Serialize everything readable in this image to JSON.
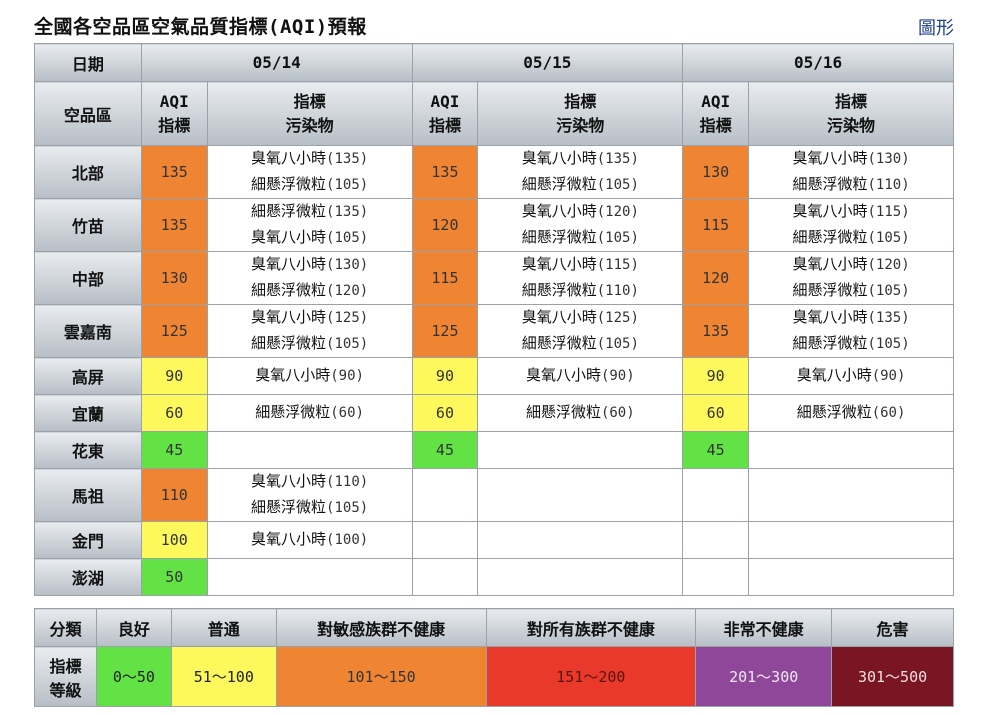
{
  "title": {
    "prefix": "全國各空品區空氣品質指標",
    "code": "(AQI)",
    "suffix": "預報"
  },
  "chart_link": "圖形",
  "header": {
    "date_label": "日期",
    "region_label": "空品區",
    "aqi_label_1": "AQI",
    "aqi_label_2": "指標",
    "poll_label_1": "指標",
    "poll_label_2": "污染物",
    "dates": [
      "05/14",
      "05/15",
      "05/16"
    ]
  },
  "regions": [
    {
      "name": "北部",
      "days": [
        {
          "aqi": "135",
          "level": "orange",
          "pollutants": [
            "臭氧八小時",
            "(135)",
            "細懸浮微粒",
            "(105)"
          ]
        },
        {
          "aqi": "135",
          "level": "orange",
          "pollutants": [
            "臭氧八小時",
            "(135)",
            "細懸浮微粒",
            "(105)"
          ]
        },
        {
          "aqi": "130",
          "level": "orange",
          "pollutants": [
            "臭氧八小時",
            "(130)",
            "細懸浮微粒",
            "(110)"
          ]
        }
      ]
    },
    {
      "name": "竹苗",
      "days": [
        {
          "aqi": "135",
          "level": "orange",
          "pollutants": [
            "細懸浮微粒",
            "(135)",
            "臭氧八小時",
            "(105)"
          ]
        },
        {
          "aqi": "120",
          "level": "orange",
          "pollutants": [
            "臭氧八小時",
            "(120)",
            "細懸浮微粒",
            "(105)"
          ]
        },
        {
          "aqi": "115",
          "level": "orange",
          "pollutants": [
            "臭氧八小時",
            "(115)",
            "細懸浮微粒",
            "(105)"
          ]
        }
      ]
    },
    {
      "name": "中部",
      "days": [
        {
          "aqi": "130",
          "level": "orange",
          "pollutants": [
            "臭氧八小時",
            "(130)",
            "細懸浮微粒",
            "(120)"
          ]
        },
        {
          "aqi": "115",
          "level": "orange",
          "pollutants": [
            "臭氧八小時",
            "(115)",
            "細懸浮微粒",
            "(110)"
          ]
        },
        {
          "aqi": "120",
          "level": "orange",
          "pollutants": [
            "臭氧八小時",
            "(120)",
            "細懸浮微粒",
            "(105)"
          ]
        }
      ]
    },
    {
      "name": "雲嘉南",
      "days": [
        {
          "aqi": "125",
          "level": "orange",
          "pollutants": [
            "臭氧八小時",
            "(125)",
            "細懸浮微粒",
            "(105)"
          ]
        },
        {
          "aqi": "125",
          "level": "orange",
          "pollutants": [
            "臭氧八小時",
            "(125)",
            "細懸浮微粒",
            "(105)"
          ]
        },
        {
          "aqi": "135",
          "level": "orange",
          "pollutants": [
            "臭氧八小時",
            "(135)",
            "細懸浮微粒",
            "(105)"
          ]
        }
      ]
    },
    {
      "name": "高屏",
      "days": [
        {
          "aqi": "90",
          "level": "yellow",
          "pollutants": [
            "臭氧八小時",
            "(90)"
          ]
        },
        {
          "aqi": "90",
          "level": "yellow",
          "pollutants": [
            "臭氧八小時",
            "(90)"
          ]
        },
        {
          "aqi": "90",
          "level": "yellow",
          "pollutants": [
            "臭氧八小時",
            "(90)"
          ]
        }
      ]
    },
    {
      "name": "宜蘭",
      "days": [
        {
          "aqi": "60",
          "level": "yellow",
          "pollutants": [
            "細懸浮微粒",
            "(60)"
          ]
        },
        {
          "aqi": "60",
          "level": "yellow",
          "pollutants": [
            "細懸浮微粒",
            "(60)"
          ]
        },
        {
          "aqi": "60",
          "level": "yellow",
          "pollutants": [
            "細懸浮微粒",
            "(60)"
          ]
        }
      ]
    },
    {
      "name": "花東",
      "days": [
        {
          "aqi": "45",
          "level": "green",
          "pollutants": []
        },
        {
          "aqi": "45",
          "level": "green",
          "pollutants": []
        },
        {
          "aqi": "45",
          "level": "green",
          "pollutants": []
        }
      ]
    },
    {
      "name": "馬祖",
      "days": [
        {
          "aqi": "110",
          "level": "orange",
          "pollutants": [
            "臭氧八小時",
            "(110)",
            "細懸浮微粒",
            "(105)"
          ]
        },
        {
          "aqi": "",
          "level": "",
          "pollutants": []
        },
        {
          "aqi": "",
          "level": "",
          "pollutants": []
        }
      ]
    },
    {
      "name": "金門",
      "days": [
        {
          "aqi": "100",
          "level": "yellow",
          "pollutants": [
            "臭氧八小時",
            "(100)"
          ]
        },
        {
          "aqi": "",
          "level": "",
          "pollutants": []
        },
        {
          "aqi": "",
          "level": "",
          "pollutants": []
        }
      ]
    },
    {
      "name": "澎湖",
      "days": [
        {
          "aqi": "50",
          "level": "green",
          "pollutants": []
        },
        {
          "aqi": "",
          "level": "",
          "pollutants": []
        },
        {
          "aqi": "",
          "level": "",
          "pollutants": []
        }
      ]
    }
  ],
  "legend": {
    "category_label": "分類",
    "index_label_1": "指標",
    "index_label_2": "等級",
    "levels": [
      {
        "name": "良好",
        "range": "0～50",
        "color": "#63e246"
      },
      {
        "name": "普通",
        "range": "51～100",
        "color": "#fdf95c"
      },
      {
        "name": "對敏感族群不健康",
        "range": "101～150",
        "color": "#ef8533"
      },
      {
        "name": "對所有族群不健康",
        "range": "151～200",
        "color": "#e8392b"
      },
      {
        "name": "非常不健康",
        "range": "201～300",
        "color": "#8e4799"
      },
      {
        "name": "危害",
        "range": "301～500",
        "color": "#7a1624"
      }
    ]
  }
}
